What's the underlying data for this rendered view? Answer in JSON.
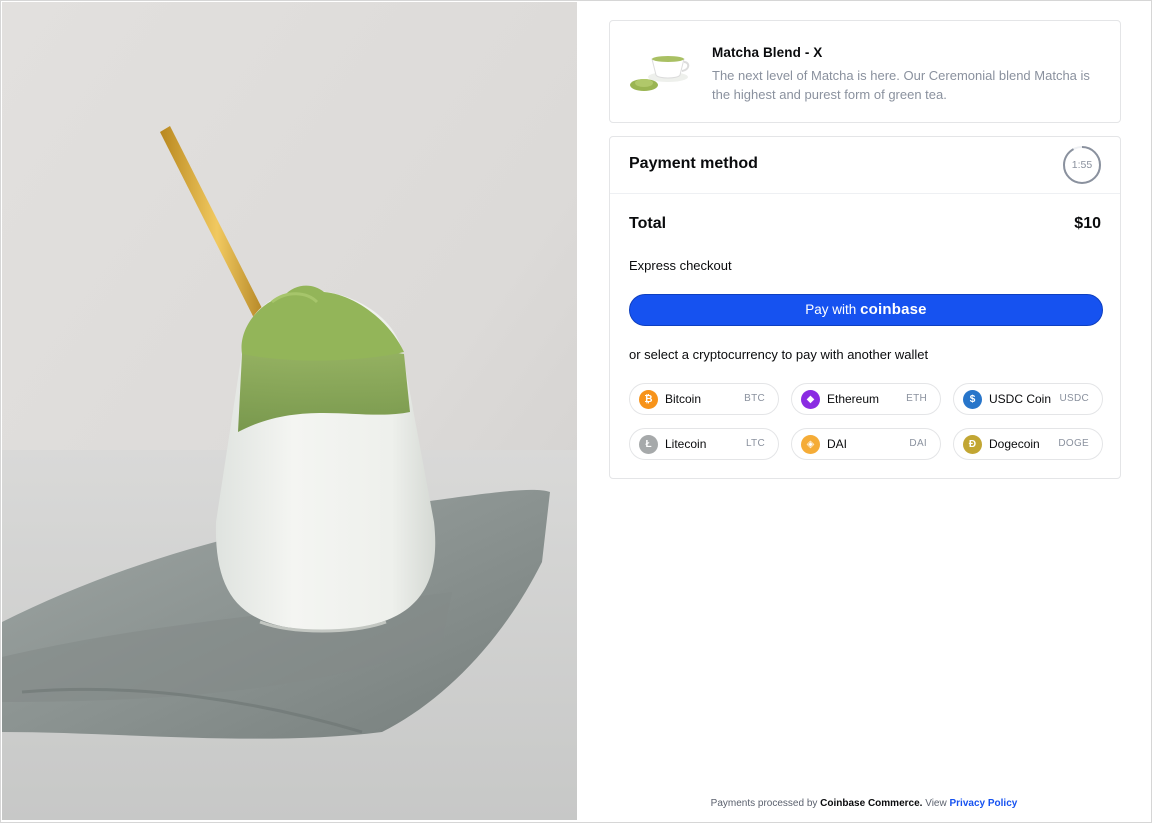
{
  "product": {
    "name": "Matcha Blend - X",
    "description": "The next level of Matcha is here. Our Ceremonial blend Matcha is the highest and purest form of green tea."
  },
  "payment": {
    "title": "Payment method",
    "timer": "1:55",
    "timer_progress": 0.92,
    "total_label": "Total",
    "total_value": "$10",
    "express_label": "Express checkout",
    "button_prefix": "Pay with",
    "button_brand": "coinbase",
    "alt_label": "or select a cryptocurrency to pay with another wallet"
  },
  "coins": [
    {
      "name": "Bitcoin",
      "symbol": "BTC",
      "icon": "bitcoin-icon",
      "glyph": "₿",
      "color": "#f7931a"
    },
    {
      "name": "Ethereum",
      "symbol": "ETH",
      "icon": "ethereum-icon",
      "glyph": "◆",
      "color": "#8a2be2"
    },
    {
      "name": "USDC Coin",
      "symbol": "USDC",
      "icon": "usdc-icon",
      "glyph": "$",
      "color": "#2775ca"
    },
    {
      "name": "Litecoin",
      "symbol": "LTC",
      "icon": "litecoin-icon",
      "glyph": "Ł",
      "color": "#a6a9aa"
    },
    {
      "name": "DAI",
      "symbol": "DAI",
      "icon": "dai-icon",
      "glyph": "◈",
      "color": "#f5ac37"
    },
    {
      "name": "Dogecoin",
      "symbol": "DOGE",
      "icon": "dogecoin-icon",
      "glyph": "Ð",
      "color": "#c2a633"
    }
  ],
  "footer": {
    "prefix": "Payments processed by",
    "processor": "Coinbase Commerce.",
    "view": "View",
    "link": "Privacy Policy"
  },
  "colors": {
    "accent": "#1652f0",
    "muted_text": "#8a919e",
    "border": "#e4e5e7"
  }
}
